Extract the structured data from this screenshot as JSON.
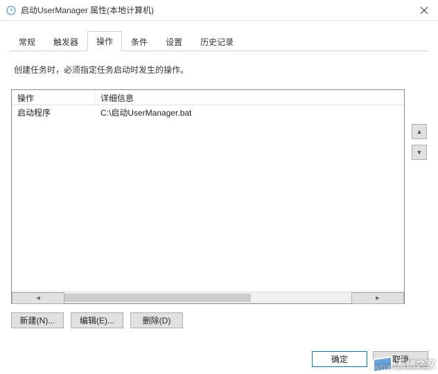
{
  "window": {
    "title": "启动UserManager 属性(本地计算机)"
  },
  "tabs": [
    {
      "label": "常规"
    },
    {
      "label": "触发器"
    },
    {
      "label": "操作",
      "active": true
    },
    {
      "label": "条件"
    },
    {
      "label": "设置"
    },
    {
      "label": "历史记录"
    }
  ],
  "description": "创建任务时，必须指定任务启动时发生的操作。",
  "table": {
    "headers": {
      "col1": "操作",
      "col2": "详细信息"
    },
    "rows": [
      {
        "col1": "启动程序",
        "col2": "C:\\启动UserManager.bat"
      }
    ]
  },
  "side": {
    "up": "▲",
    "down": "▼"
  },
  "actions": {
    "new": "新建(N)...",
    "edit": "编辑(E)...",
    "delete": "删除(D)"
  },
  "footer": {
    "ok": "确定",
    "cancel": "取消"
  },
  "watermark": {
    "text": "系统之家",
    "sub": "XITONGZHIJIA.NET"
  }
}
